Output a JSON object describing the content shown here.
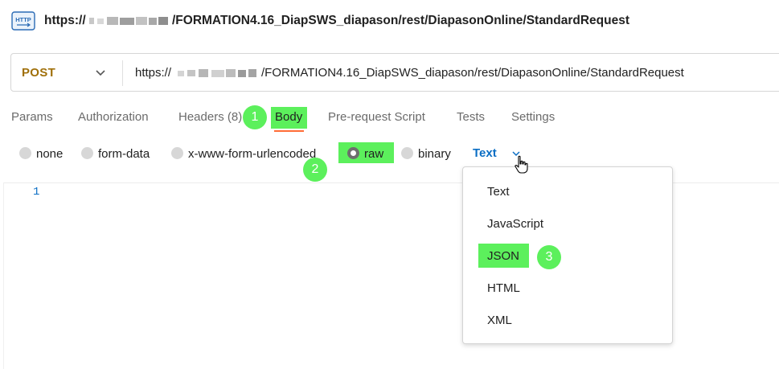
{
  "request_title": {
    "prefix": "https://",
    "suffix": "/FORMATION4.16_DiapSWS_diapason/rest/DiapasonOnline/StandardRequest"
  },
  "request_bar": {
    "method": "POST",
    "url_prefix": "https://",
    "url_suffix": "/FORMATION4.16_DiapSWS_diapason/rest/DiapasonOnline/StandardRequest"
  },
  "tabs": {
    "params": "Params",
    "authorization": "Authorization",
    "headers": "Headers (8)",
    "body": "Body",
    "pre_request_script": "Pre-request Script",
    "tests": "Tests",
    "settings": "Settings"
  },
  "body_types": {
    "none": "none",
    "form_data": "form-data",
    "urlencoded": "x-www-form-urlencoded",
    "raw": "raw",
    "binary": "binary",
    "selected": "raw"
  },
  "language_selector": {
    "value": "Text"
  },
  "editor": {
    "line_number": "1"
  },
  "language_dropdown": {
    "items": [
      "Text",
      "JavaScript",
      "JSON",
      "HTML",
      "XML"
    ],
    "highlighted": "JSON"
  },
  "annotations": {
    "step1": "1",
    "step2": "2",
    "step3": "3"
  },
  "colors": {
    "highlight": "#5cf05c",
    "method": "#a0700a",
    "link_blue": "#0b6ec4",
    "active_tab_underline": "#ff6c37"
  },
  "icons": [
    "http-icon",
    "chevron-down-icon",
    "hand-cursor-icon"
  ]
}
